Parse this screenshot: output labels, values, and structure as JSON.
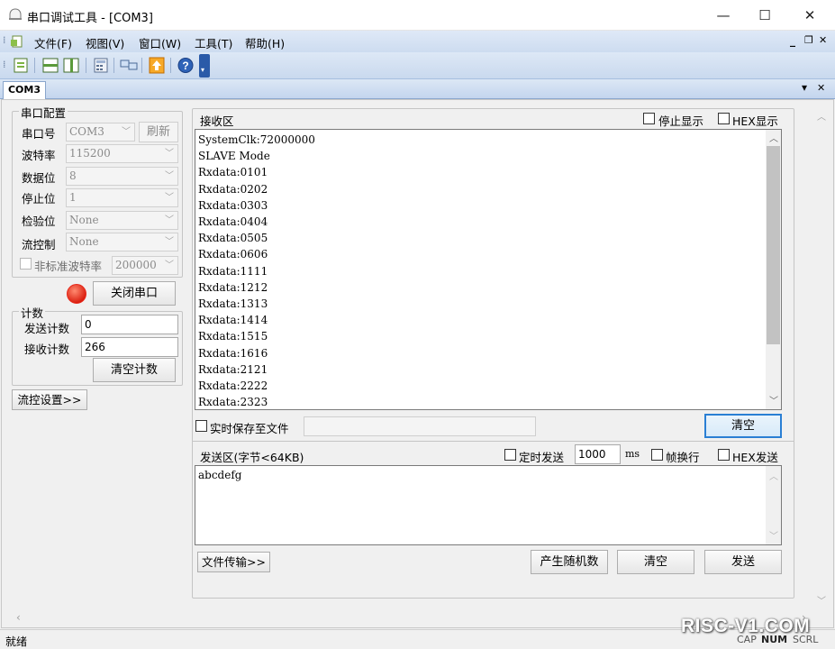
{
  "window": {
    "title": "串口调试工具 - [COM3]",
    "minimize": "—",
    "maximize": "☐",
    "close": "✕"
  },
  "menu": [
    "文件(F)",
    "视图(V)",
    "窗口(W)",
    "工具(T)",
    "帮助(H)"
  ],
  "mdi_controls": {
    "minimize": "_",
    "restore": "❐",
    "close": "✕"
  },
  "tab": {
    "label": "COM3",
    "dropdown": "▾",
    "close": "✕"
  },
  "serial": {
    "group_title": "串口配置",
    "port_label": "串口号",
    "port_value": "COM3",
    "refresh_button": "刷新",
    "baud_label": "波特率",
    "baud_value": "115200",
    "databits_label": "数据位",
    "databits_value": "8",
    "stopbits_label": "停止位",
    "stopbits_value": "1",
    "parity_label": "检验位",
    "parity_value": "None",
    "flow_label": "流控制",
    "flow_value": "None",
    "nonstd_label": "非标准波特率",
    "nonstd_value": "200000",
    "status_color": "#e8281a",
    "close_port_button": "关闭串口"
  },
  "counts": {
    "group_title": "计数",
    "send_label": "发送计数",
    "send_value": "0",
    "recv_label": "接收计数",
    "recv_value": "266",
    "clear_button": "清空计数"
  },
  "flow_settings_button": "流控设置>>",
  "receive": {
    "title": "接收区",
    "stop_display_label": "停止显示",
    "hex_display_label": "HEX显示",
    "lines": [
      "SystemClk:72000000",
      "SLAVE Mode",
      "Rxdata:0101",
      "Rxdata:0202",
      "Rxdata:0303",
      "Rxdata:0404",
      "Rxdata:0505",
      "Rxdata:0606",
      "Rxdata:1111",
      "Rxdata:1212",
      "Rxdata:1313",
      "Rxdata:1414",
      "Rxdata:1515",
      "Rxdata:1616",
      "Rxdata:2121",
      "Rxdata:2222",
      "Rxdata:2323"
    ],
    "save_to_file_label": "实时保存至文件",
    "save_path": "",
    "clear_button": "清空"
  },
  "send": {
    "title": "发送区(字节<64KB)",
    "timed_send_label": "定时发送",
    "interval_value": "1000",
    "interval_unit": "ms",
    "newline_label": "帧换行",
    "hex_send_label": "HEX发送",
    "text": "abcdefg",
    "file_transfer_button": "文件传输>>",
    "random_button": "产生随机数",
    "clear_button": "清空",
    "send_button": "发送"
  },
  "statusbar": {
    "status": "就绪",
    "indicators": [
      "CAP",
      "NUM",
      "SCRL"
    ],
    "watermark": "RISC-V1.COM"
  }
}
